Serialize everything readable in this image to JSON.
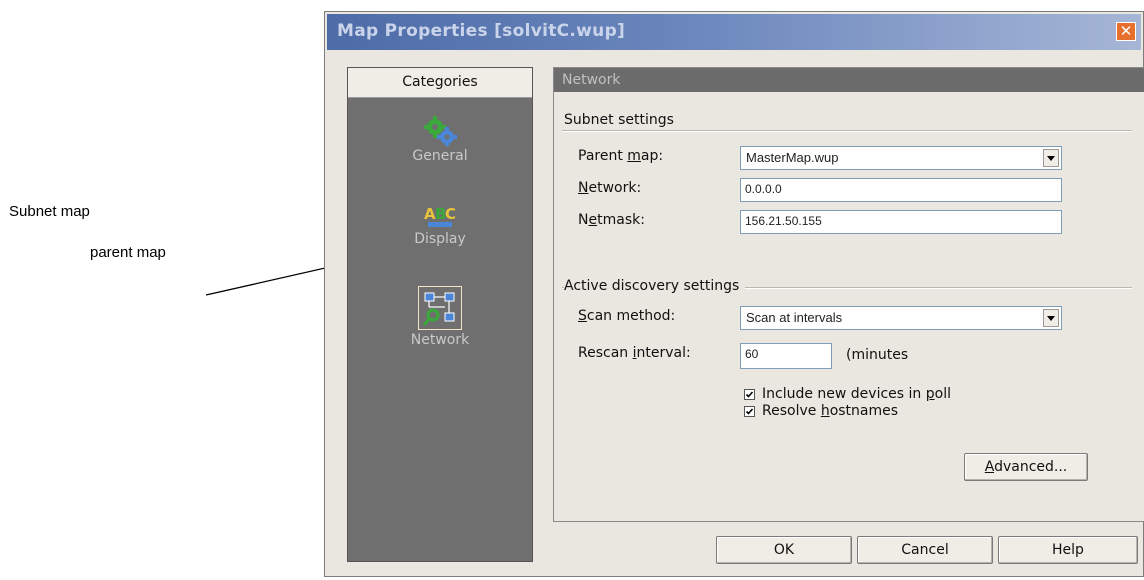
{
  "annotations": {
    "subnet_map": "Subnet map",
    "parent_map": "parent map"
  },
  "dialog": {
    "title": "Map Properties [solvitC.wup]",
    "close_symbol": "✕"
  },
  "categories": {
    "header": "Categories",
    "items": [
      {
        "label": "General",
        "icon": "gears-icon"
      },
      {
        "label": "Display",
        "icon": "abc-display-icon"
      },
      {
        "label": "Network",
        "icon": "network-icon",
        "selected": true
      }
    ]
  },
  "panel": {
    "header": "Network",
    "subnet_group": "Subnet settings",
    "parent_map_label_pre": "Parent ",
    "parent_map_label_u": "m",
    "parent_map_label_post": "ap:",
    "parent_map_value": "MasterMap.wup",
    "network_label_u": "N",
    "network_label_post": "etwork:",
    "network_value": "0.0.0.0",
    "netmask_label_pre": "N",
    "netmask_label_u": "e",
    "netmask_label_post": "tmask:",
    "netmask_value": "156.21.50.155",
    "discovery_group": "Active discovery settings",
    "scan_method_label_u": "S",
    "scan_method_label_post": "can method:",
    "scan_method_value": "Scan at intervals",
    "rescan_label_pre": "Rescan ",
    "rescan_label_u": "i",
    "rescan_label_post": "nterval:",
    "rescan_value": "60",
    "rescan_unit": "(minutes",
    "include_label_pre": "Include new devices in ",
    "include_label_u": "p",
    "include_label_post": "oll",
    "include_checked": true,
    "resolve_label_pre": "Resolve ",
    "resolve_label_u": "h",
    "resolve_label_post": "ostnames",
    "resolve_checked": true,
    "advanced_pre": "",
    "advanced_u": "A",
    "advanced_post": "dvanced..."
  },
  "buttons": {
    "ok": "OK",
    "cancel": "Cancel",
    "help": "Help"
  },
  "colors": {
    "titlebar_start": "#4d6ba7",
    "titlebar_end": "#a6b6d6",
    "close_button": "#e8702f",
    "pane_bg": "#6f6f6f",
    "dialog_bg": "#e9e7e0"
  }
}
